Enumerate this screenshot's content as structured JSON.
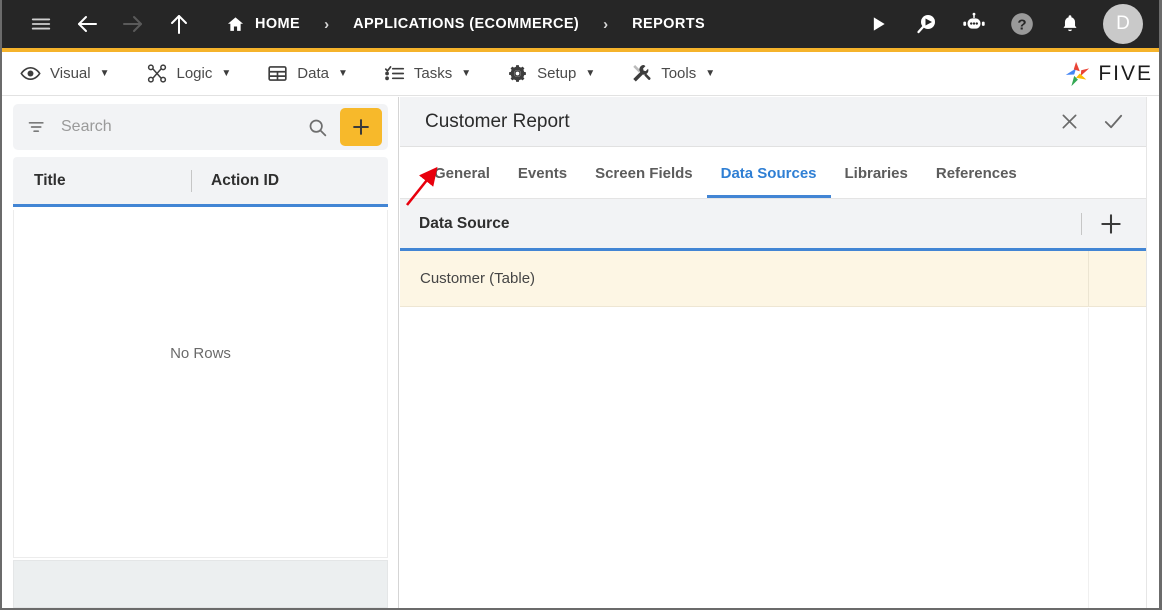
{
  "topbar": {
    "menu_icon": "hamburger-menu-icon",
    "back_icon": "back-arrow-icon",
    "forward_icon": "forward-arrow-icon",
    "up_icon": "up-arrow-icon",
    "breadcrumb": [
      {
        "label": "HOME",
        "icon": "home-icon"
      },
      {
        "label": "APPLICATIONS (ECOMMERCE)",
        "icon": ""
      },
      {
        "label": "REPORTS",
        "icon": ""
      }
    ],
    "separator": "›",
    "actions": [
      {
        "name": "run-icon",
        "label": "Run"
      },
      {
        "name": "search-video-icon",
        "label": "Search"
      },
      {
        "name": "chat-bot-icon",
        "label": "Assistant"
      },
      {
        "name": "help-icon",
        "label": "Help"
      },
      {
        "name": "notifications-bell-icon",
        "label": "Notifications"
      }
    ],
    "avatar_initial": "D",
    "accent_color": "#F5B32B",
    "background_color": "#262626"
  },
  "menubar": {
    "items": [
      {
        "label": "Visual",
        "icon": "eye-icon",
        "caret": "▼"
      },
      {
        "label": "Logic",
        "icon": "logic-nodes-icon",
        "caret": "▼"
      },
      {
        "label": "Data",
        "icon": "table-grid-icon",
        "caret": "▼"
      },
      {
        "label": "Tasks",
        "icon": "checklist-icon",
        "caret": "▼"
      },
      {
        "label": "Setup",
        "icon": "gear-icon",
        "caret": "▼"
      },
      {
        "label": "Tools",
        "icon": "tools-icon",
        "caret": "▼"
      }
    ],
    "logo_text": "FIVE"
  },
  "left_panel": {
    "search": {
      "placeholder": "Search",
      "value": "",
      "filter_icon": "filter-icon",
      "search_icon": "search-icon"
    },
    "add_button_label": "+",
    "add_button_color": "#F7B92B",
    "columns": [
      "Title",
      "Action ID"
    ],
    "rows": [],
    "empty_message": "No Rows"
  },
  "right_panel": {
    "title": "Customer Report",
    "header_actions": [
      {
        "name": "close-icon",
        "label": "✕"
      },
      {
        "name": "confirm-check-icon",
        "label": "✓"
      }
    ],
    "tabs": [
      {
        "label": "General",
        "active": false
      },
      {
        "label": "Events",
        "active": false
      },
      {
        "label": "Screen Fields",
        "active": false
      },
      {
        "label": "Data Sources",
        "active": true
      },
      {
        "label": "Libraries",
        "active": false
      },
      {
        "label": "References",
        "active": false
      }
    ],
    "active_tab_color": "#2f7fd4",
    "grid": {
      "column_header": "Data Source",
      "add_icon": "add-plus-icon",
      "rows": [
        {
          "data_source": "Customer (Table)",
          "selected": true
        }
      ],
      "selected_row_color": "#fdf6e4"
    }
  },
  "annotation": {
    "type": "arrow",
    "color": "#e8000d",
    "points_at": "General"
  }
}
